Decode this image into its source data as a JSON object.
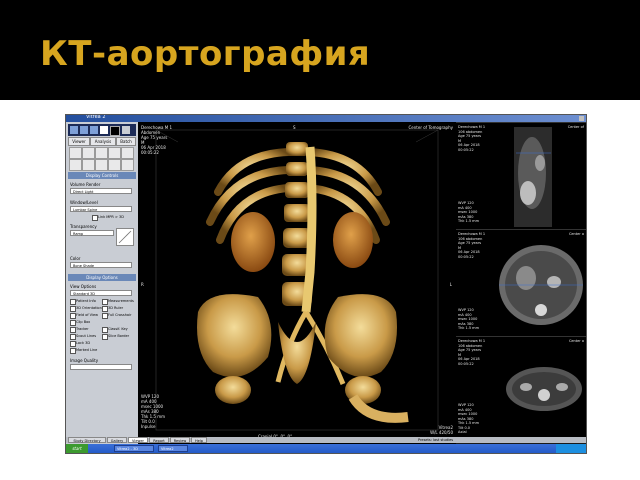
{
  "slide": {
    "title": "КТ-аортография"
  },
  "window": {
    "title": "Vitrea 2"
  },
  "left_panel": {
    "tabs": [
      "Viewer",
      "Analysis",
      "Batch"
    ],
    "sections": [
      {
        "title": "Display Controls"
      },
      {
        "title": "Display Options"
      }
    ],
    "volume_render": {
      "label": "Volume Render",
      "value": "Direct Light"
    },
    "window_level": {
      "label": "Window/Level",
      "value": "Lumbar Spine"
    },
    "link_mpr": "Link MPR > 3D",
    "transparency": {
      "label": "Transparency",
      "value": "Ramp"
    },
    "color": {
      "label": "Color",
      "value": "Bone Shade"
    },
    "view_options": {
      "label": "View Options",
      "value": "Standard 3D"
    },
    "checkboxes": [
      "Patient Info",
      "Measurements",
      "3D Orientation",
      "3D Ruler",
      "Field of View",
      "Full Crosshair",
      "Clip Box",
      "Tracker",
      "Classif. Key",
      "Scout Lines",
      "Slice Border",
      "Lock 3D",
      "Marked Line"
    ],
    "image_quality": {
      "label": "Image Quality",
      "value": ""
    }
  },
  "main_view": {
    "overlay_tl": [
      "Derechowa M 1",
      "Abdomen",
      "Age 75 years",
      "M",
      "06 Apr 2018",
      "00:05:22"
    ],
    "overlay_tc": "S",
    "overlay_tr": "Center of Tomography",
    "overlay_ll": [
      "WVP 120",
      "mA 400",
      "msec 1000",
      "mAs 380",
      "Thk 1.5 mm",
      "Tilt 0.0",
      "Inpulse"
    ],
    "overlay_bc": "Cranial 0°, 0°, 0°",
    "overlay_br": [
      "Vitrea2",
      "W/L 420/50"
    ],
    "overlay_r": "L",
    "overlay_l": "R"
  },
  "right_views": [
    {
      "overlay_tl": [
        "Derechowa M 1",
        "106 abdomen",
        "Age 75 years",
        "M",
        "06 Apr 2018",
        "00:05:22"
      ],
      "overlay_tr": "Center of",
      "overlay_ll": [
        "WVP 120",
        "mA 400",
        "msec 1000",
        "mAs 380",
        "Thk 1.5 mm"
      ]
    },
    {
      "overlay_tl": [
        "Derechowa M 1",
        "106 abdomen",
        "Age 75 years",
        "M",
        "06 Apr 2018",
        "00:05:22"
      ],
      "overlay_tr": "Center o",
      "overlay_ll": [
        "WVP 120",
        "mA 400",
        "msec 1000",
        "mAs 380",
        "Thk 1.5 mm"
      ]
    },
    {
      "overlay_tl": [
        "Derechowa M 1",
        "106 abdomen",
        "Age 75 years",
        "M",
        "06 Apr 2018",
        "00:05:22"
      ],
      "overlay_tr": "Center o",
      "overlay_ll": [
        "WVP 120",
        "mA 400",
        "msec 1000",
        "mAs 380",
        "Thk 1.5 mm",
        "Tilt 0.0",
        "Axial"
      ]
    }
  ],
  "bottom_tabs": [
    "Study Directory",
    "Gallery",
    "Viewer",
    "Report",
    "Review",
    "Help"
  ],
  "status_text": "Presets: last studies",
  "taskbar": {
    "start": "start",
    "tasks": [
      "Vitrea2 - 3D",
      "Vitrea2"
    ]
  }
}
